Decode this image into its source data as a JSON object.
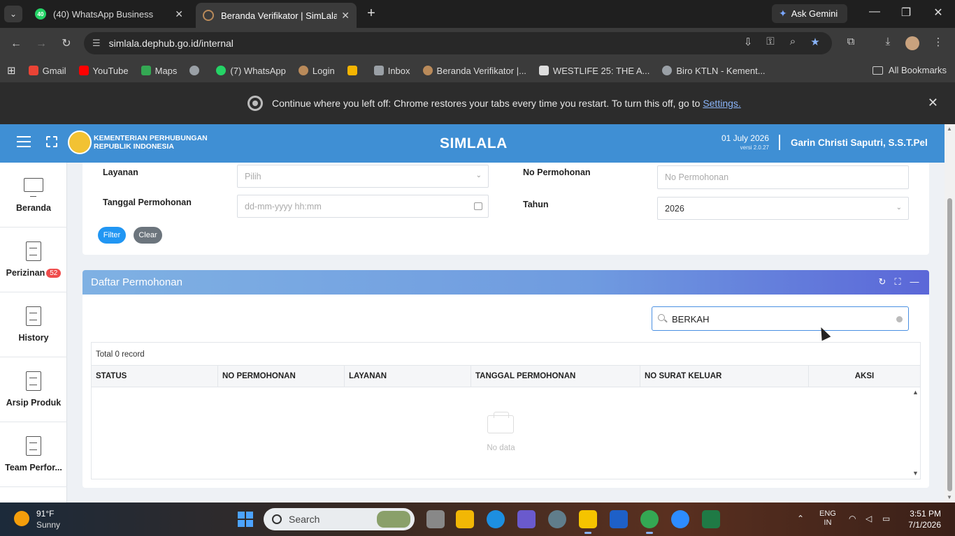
{
  "browser": {
    "tabs": [
      {
        "title": "(40) WhatsApp Business",
        "badge": "40"
      },
      {
        "title": "Beranda Verifikator | SimLala"
      }
    ],
    "ask_gemini": "Ask Gemini",
    "url": "simlala.dephub.go.id/internal",
    "bookmarks": [
      {
        "label": "Gmail",
        "color": "#ea4335"
      },
      {
        "label": "YouTube",
        "color": "#ff0000"
      },
      {
        "label": "Maps",
        "color": "#34a853"
      },
      {
        "label": "",
        "color": "#9aa0a6"
      },
      {
        "label": "(7) WhatsApp",
        "color": "#25d366"
      },
      {
        "label": "Login",
        "color": "#b98a5a"
      },
      {
        "label": "",
        "color": "#f4b400"
      },
      {
        "label": "Inbox",
        "color": "#9aa0a6"
      },
      {
        "label": "Beranda Verifikator |...",
        "color": "#b98a5a"
      },
      {
        "label": "WESTLIFE 25: THE A...",
        "color": "#dddddd"
      },
      {
        "label": "Biro KTLN - Kement...",
        "color": "#9aa0a6"
      }
    ],
    "all_bookmarks": "All Bookmarks",
    "notice": {
      "text": "Continue where you left off: Chrome restores your tabs every time you restart. To turn this off, go to ",
      "link": "Settings."
    }
  },
  "app": {
    "ministry_line1": "KEMENTERIAN PERHUBUNGAN",
    "ministry_line2": "REPUBLIK INDONESIA",
    "brand": "SIMLALA",
    "date": "01 July 2026",
    "version": "versi 2.0.27",
    "user": "Garin Christi Saputri, S.S.T.Pel",
    "sidebar": [
      {
        "label": "Beranda",
        "icon": "monitor-icon"
      },
      {
        "label": "Perizinan",
        "icon": "document-icon",
        "badge": "52"
      },
      {
        "label": "History",
        "icon": "document-icon"
      },
      {
        "label": "Arsip Produk",
        "icon": "document-icon"
      },
      {
        "label": "Team Perfor...",
        "icon": "document-icon"
      }
    ],
    "filter": {
      "layanan_label": "Layanan",
      "layanan_value": "Pilih",
      "tanggal_label": "Tanggal Permohonan",
      "tanggal_placeholder": "dd-mm-yyyy hh:mm",
      "no_label": "No Permohonan",
      "no_placeholder": "No Permohonan",
      "tahun_label": "Tahun",
      "tahun_value": "2026",
      "filter_button": "Filter",
      "clear_button": "Clear"
    },
    "list": {
      "title": "Daftar Permohonan",
      "search_value": "BERKAH",
      "total": "Total 0 record",
      "columns": [
        "STATUS",
        "NO PERMOHONAN",
        "LAYANAN",
        "TANGGAL PERMOHONAN",
        "NO SURAT KELUAR",
        "AKSI"
      ],
      "empty": "No data"
    }
  },
  "taskbar": {
    "temperature": "91°F",
    "condition": "Sunny",
    "search": "Search",
    "lang1": "ENG",
    "lang2": "IN",
    "time": "3:51 PM",
    "date": "7/1/2026"
  }
}
